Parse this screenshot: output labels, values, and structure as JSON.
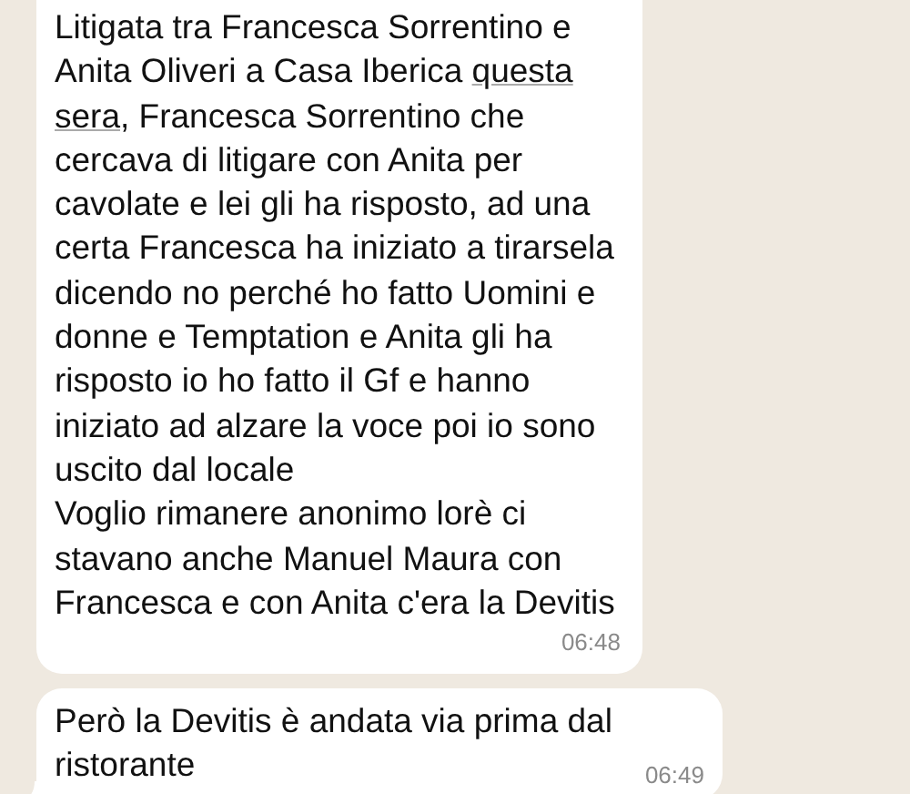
{
  "messages": [
    {
      "segments": [
        {
          "kind": "text",
          "text": "Litigata tra Francesca Sorrentino e Anita Oliveri a Casa Iberica "
        },
        {
          "kind": "link",
          "text": "questa "
        },
        {
          "kind": "link",
          "text": "sera"
        },
        {
          "kind": "text",
          "text": ", Francesca Sorrentino che cercava di litigare con Anita per cavolate e lei gli ha risposto, ad una certa Francesca ha iniziato a tirarsela dicendo no perché ho fatto Uomini e donne e Temptation e Anita gli ha risposto io ho fatto il Gf e hanno iniziato ad alzare la voce poi io sono uscito dal locale\nVoglio rimanere anonimo lorè ci stavano anche Manuel Maura con Francesca e con Anita c'era la Devitis"
        }
      ],
      "time": "06:48",
      "tail": false,
      "cut_top": true
    },
    {
      "segments": [
        {
          "kind": "text",
          "text": "Però la Devitis è andata via prima dal ristorante"
        }
      ],
      "time": "06:49",
      "tail": true,
      "cut_top": false
    }
  ]
}
